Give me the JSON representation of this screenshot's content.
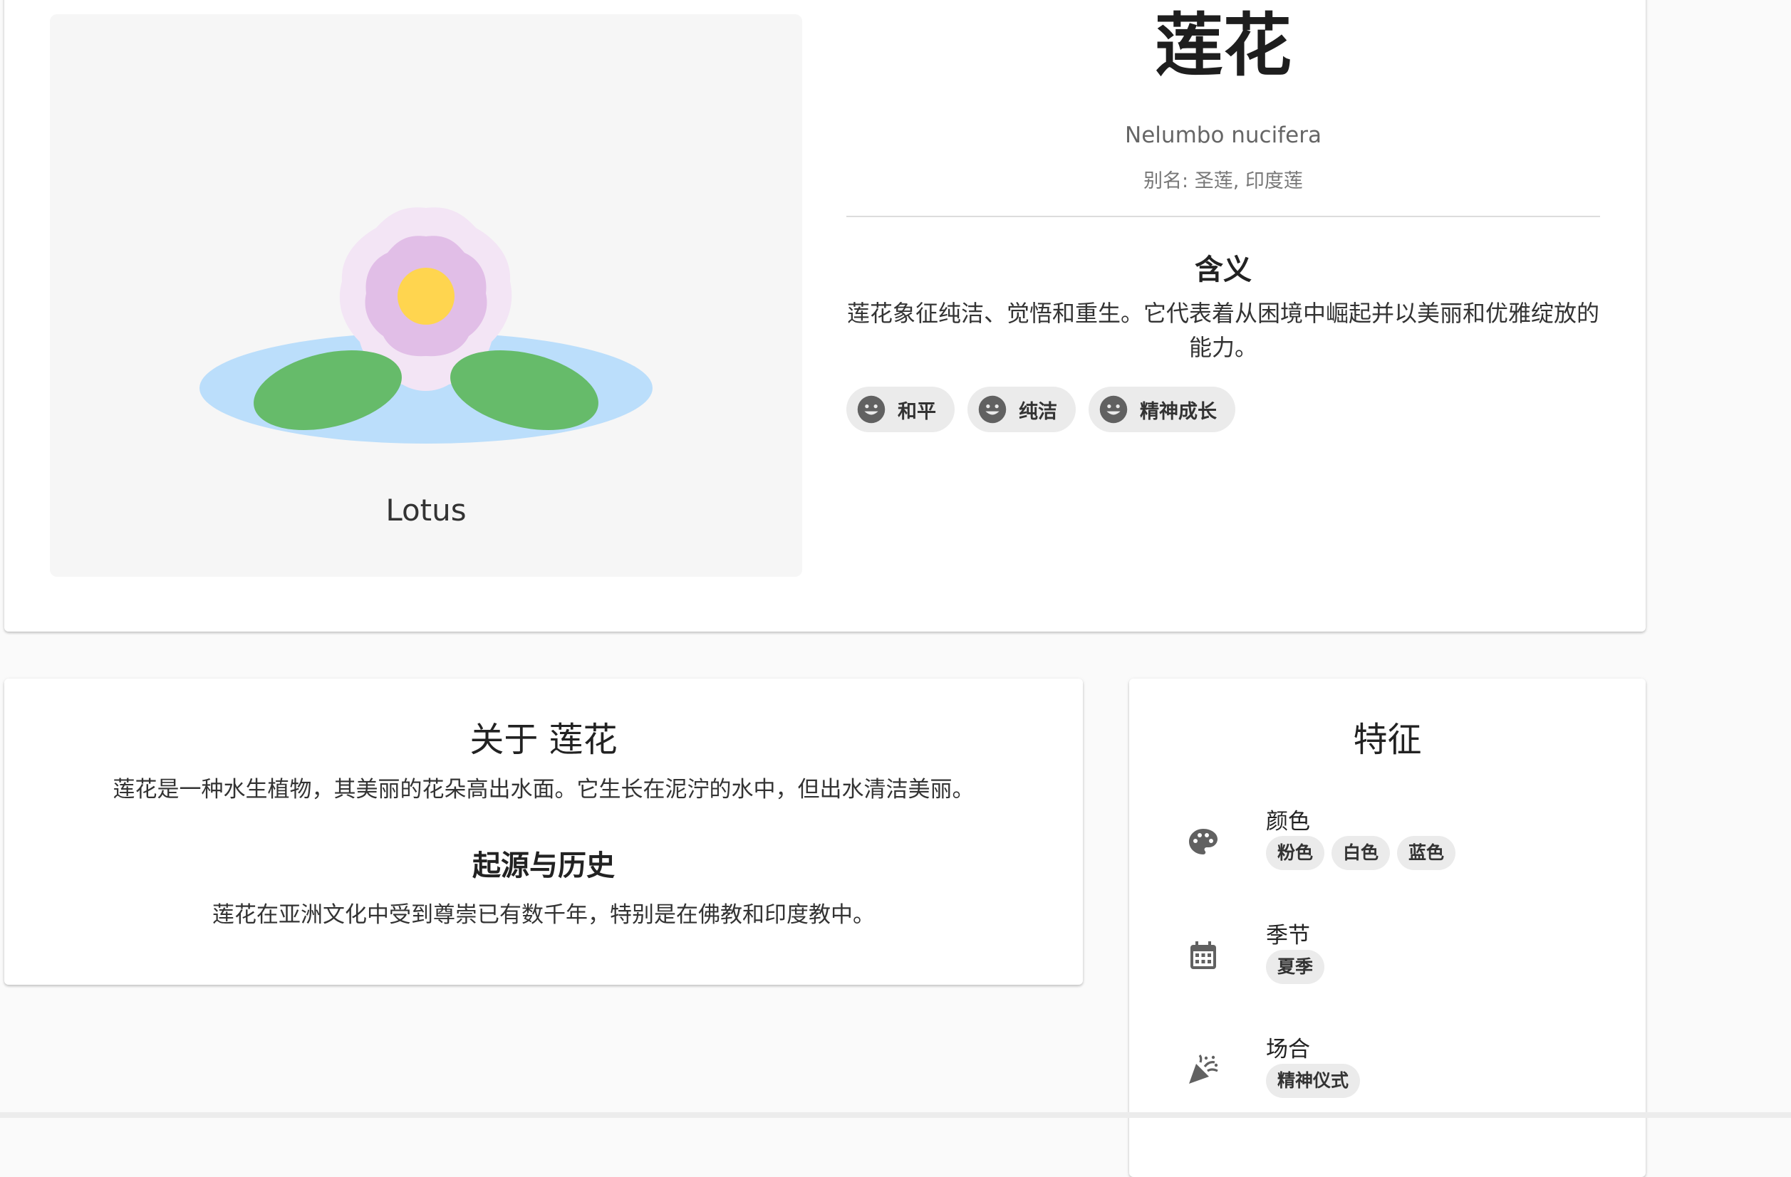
{
  "hero": {
    "image_caption": "Lotus",
    "title": "莲花",
    "scientific_name": "Nelumbo nucifera",
    "alias": "别名: 圣莲, 印度莲",
    "meaning_heading": "含义",
    "meaning_text": "莲花象征纯洁、觉悟和重生。它代表着从困境中崛起并以美丽和优雅绽放的能力。",
    "chips": [
      {
        "label": "和平",
        "icon": "smiley-face-icon"
      },
      {
        "label": "纯洁",
        "icon": "smiley-face-icon"
      },
      {
        "label": "精神成长",
        "icon": "smiley-face-icon"
      }
    ]
  },
  "about": {
    "title": "关于 莲花",
    "text": "莲花是一种水生植物，其美丽的花朵高出水面。它生长在泥泞的水中，但出水清洁美丽。",
    "history_heading": "起源与历史",
    "history_text": "莲花在亚洲文化中受到尊崇已有数千年，特别是在佛教和印度教中。"
  },
  "features": {
    "title": "特征",
    "items": [
      {
        "label": "颜色",
        "icon": "palette-icon",
        "tags": [
          "粉色",
          "白色",
          "蓝色"
        ]
      },
      {
        "label": "季节",
        "icon": "calendar-icon",
        "tags": [
          "夏季"
        ]
      },
      {
        "label": "场合",
        "icon": "celebration-icon",
        "tags": [
          "精神仪式"
        ]
      }
    ]
  },
  "colors": {
    "water": "#bbdefb",
    "leaf": "#66bb6a",
    "petal_outer": "#f3e5f5",
    "petal_inner": "#e1bee7",
    "center": "#ffd54f",
    "icon": "#616161"
  }
}
